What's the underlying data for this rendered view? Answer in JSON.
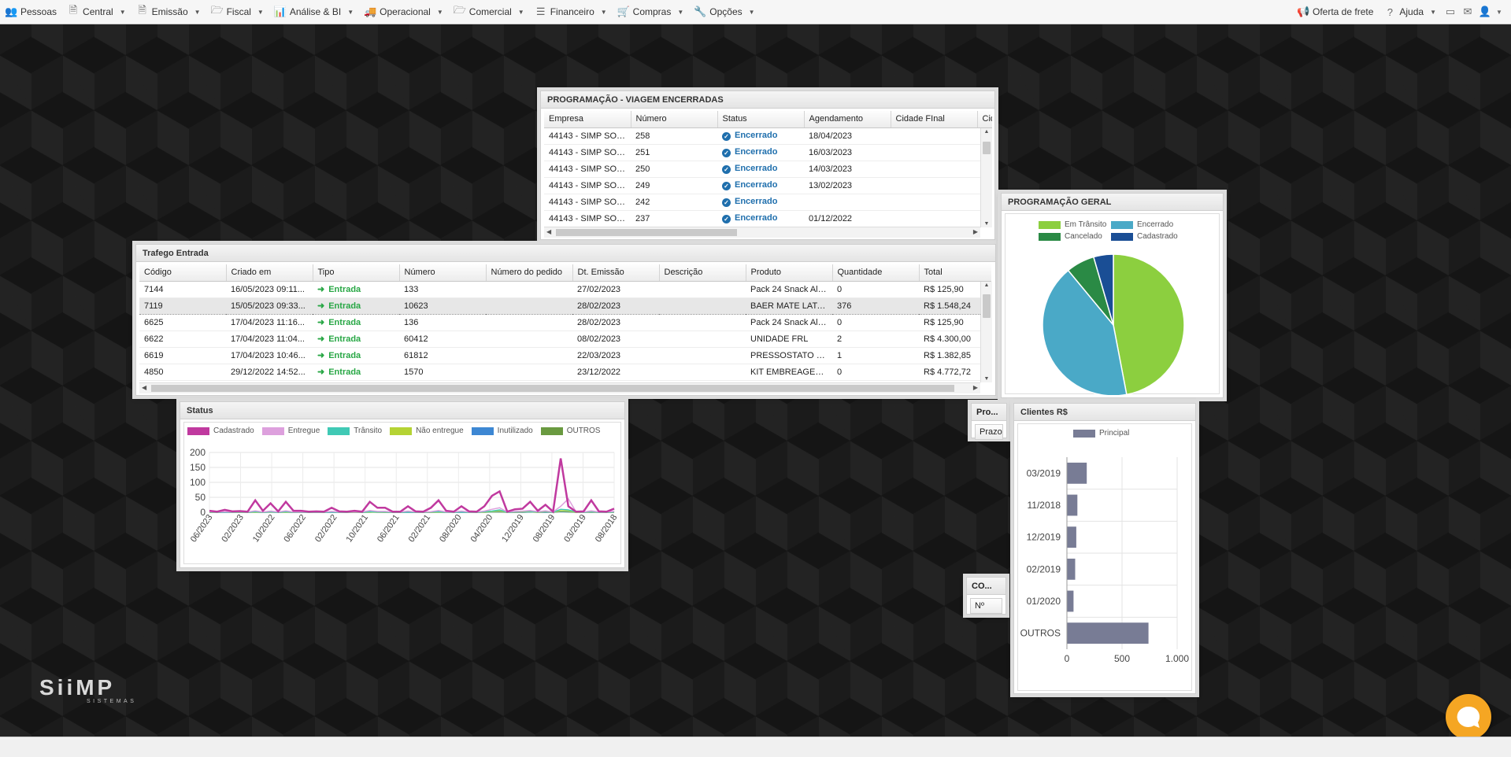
{
  "menu": {
    "items": [
      {
        "label": "Pessoas",
        "icon": "people-icon",
        "caret": false
      },
      {
        "label": "Central",
        "icon": "document-icon",
        "caret": true
      },
      {
        "label": "Emissão",
        "icon": "document-icon",
        "caret": true
      },
      {
        "label": "Fiscal",
        "icon": "folder-icon",
        "caret": true
      },
      {
        "label": "Análise & BI",
        "icon": "chart-icon",
        "caret": true
      },
      {
        "label": "Operacional",
        "icon": "truck-icon",
        "caret": true
      },
      {
        "label": "Comercial",
        "icon": "folder-icon",
        "caret": true
      },
      {
        "label": "Financeiro",
        "icon": "list-icon",
        "caret": true
      },
      {
        "label": "Compras",
        "icon": "cart-icon",
        "caret": true
      },
      {
        "label": "Opções",
        "icon": "wrench-icon",
        "caret": true
      }
    ],
    "right": {
      "frete": "Oferta de frete",
      "ajuda": "Ajuda"
    }
  },
  "viagem": {
    "title": "PROGRAMAÇÃO - VIAGEM ENCERRADAS",
    "columns": [
      "Empresa",
      "Número",
      "Status",
      "Agendamento",
      "Cidade FInal",
      "Cid"
    ],
    "rows": [
      [
        "44143 - SIMP SOF...",
        "258",
        "Encerrado",
        "18/04/2023",
        ""
      ],
      [
        "44143 - SIMP SOF...",
        "251",
        "Encerrado",
        "16/03/2023",
        ""
      ],
      [
        "44143 - SIMP SOF...",
        "250",
        "Encerrado",
        "14/03/2023",
        ""
      ],
      [
        "44143 - SIMP SOF...",
        "249",
        "Encerrado",
        "13/02/2023",
        ""
      ],
      [
        "44143 - SIMP SOF...",
        "242",
        "Encerrado",
        "",
        ""
      ],
      [
        "44143 - SIMP SOF...",
        "237",
        "Encerrado",
        "01/12/2022",
        ""
      ]
    ]
  },
  "trafego": {
    "title": "Trafego Entrada",
    "columns": [
      "Código",
      "Criado em",
      "Tipo",
      "Número",
      "Número do pedido",
      "Dt. Emissão",
      "Descrição",
      "Produto",
      "Quantidade",
      "Total"
    ],
    "rows": [
      [
        "7144",
        "16/05/2023 09:11...",
        "Entrada",
        "133",
        "",
        "27/02/2023",
        "",
        "Pack 24 Snack Alg...",
        "0",
        "R$ 125,90"
      ],
      [
        "7119",
        "15/05/2023 09:33...",
        "Entrada",
        "10623",
        "",
        "28/02/2023",
        "",
        "BAER MATE LATA ...",
        "376",
        "R$ 1.548,24"
      ],
      [
        "6625",
        "17/04/2023 11:16...",
        "Entrada",
        "136",
        "",
        "28/02/2023",
        "",
        "Pack 24 Snack Alg...",
        "0",
        "R$ 125,90"
      ],
      [
        "6622",
        "17/04/2023 11:04...",
        "Entrada",
        "60412",
        "",
        "08/02/2023",
        "",
        "UNIDADE FRL",
        "2",
        "R$ 4.300,00"
      ],
      [
        "6619",
        "17/04/2023 10:46...",
        "Entrada",
        "61812",
        "",
        "22/03/2023",
        "",
        "PRESSOSTATO DE...",
        "1",
        "R$ 1.382,85"
      ],
      [
        "4850",
        "29/12/2022 14:52...",
        "Entrada",
        "1570",
        "",
        "23/12/2022",
        "",
        "KIT EMBREAGEM ...",
        "0",
        "R$ 4.772,72"
      ]
    ],
    "selected_row": 1
  },
  "geral": {
    "title": "PROGRAMAÇÃO GERAL",
    "chart_data": {
      "type": "pie",
      "legend_position": "top",
      "slices": [
        {
          "name": "Em Trânsito",
          "value": 47,
          "color": "#8ccf3f"
        },
        {
          "name": "Encerrado",
          "value": 42,
          "color": "#4aa9c7"
        },
        {
          "name": "Cancelado",
          "value": 6.5,
          "color": "#2a8a45"
        },
        {
          "name": "Cadastrado",
          "value": 4.5,
          "color": "#1a4e95"
        }
      ]
    }
  },
  "status": {
    "title": "Status",
    "chart_data": {
      "type": "line",
      "ylim": [
        0,
        200
      ],
      "yticks": [
        "200",
        "150",
        "100",
        "50",
        "0"
      ],
      "xticks": [
        "06/2023",
        "02/2023",
        "10/2022",
        "06/2022",
        "02/2022",
        "10/2021",
        "06/2021",
        "02/2021",
        "08/2020",
        "04/2020",
        "12/2019",
        "08/2019",
        "03/2019",
        "08/2018"
      ],
      "grid": true,
      "legend_position": "top",
      "series": [
        {
          "name": "Cadastrado",
          "color": "#c0399f",
          "values": [
            5,
            2,
            8,
            3,
            4,
            2,
            40,
            5,
            30,
            3,
            35,
            5,
            5,
            2,
            3,
            2,
            15,
            3,
            2,
            5,
            2,
            35,
            15,
            15,
            2,
            2,
            20,
            3,
            2,
            15,
            40,
            5,
            2,
            20,
            3,
            2,
            20,
            55,
            70,
            2,
            10,
            12,
            35,
            5,
            25,
            2,
            180,
            20,
            2,
            3,
            40,
            3,
            2,
            12
          ]
        },
        {
          "name": "Entregue",
          "color": "#dda0dd",
          "values": [
            2,
            1,
            2,
            1,
            2,
            1,
            5,
            1,
            4,
            1,
            5,
            1,
            1,
            1,
            1,
            1,
            3,
            1,
            1,
            1,
            1,
            6,
            3,
            3,
            1,
            1,
            4,
            1,
            1,
            2,
            6,
            1,
            1,
            4,
            1,
            1,
            4,
            10,
            15,
            1,
            3,
            4,
            6,
            2,
            5,
            1,
            20,
            45,
            2,
            1,
            5,
            1,
            1,
            3
          ]
        },
        {
          "name": "Trânsito",
          "color": "#40c9b5",
          "values": [
            1,
            0,
            1,
            0,
            1,
            0,
            2,
            0,
            2,
            0,
            2,
            0,
            0,
            0,
            0,
            0,
            1,
            0,
            0,
            1,
            0,
            2,
            1,
            1,
            0,
            0,
            1,
            0,
            0,
            1,
            2,
            0,
            0,
            1,
            0,
            0,
            2,
            4,
            8,
            0,
            2,
            3,
            3,
            1,
            4,
            0,
            10,
            8,
            1,
            0,
            3,
            0,
            0,
            1
          ]
        },
        {
          "name": "Não entregue",
          "color": "#b5d334",
          "values": [
            0,
            0,
            1,
            0,
            0,
            0,
            1,
            0,
            1,
            0,
            1,
            0,
            0,
            0,
            0,
            0,
            1,
            0,
            0,
            0,
            0,
            1,
            0,
            0,
            0,
            0,
            1,
            0,
            0,
            0,
            1,
            0,
            0,
            1,
            0,
            0,
            1,
            2,
            4,
            0,
            1,
            2,
            2,
            0,
            3,
            0,
            5,
            4,
            0,
            0,
            2,
            0,
            0,
            0
          ]
        },
        {
          "name": "Inutilizado",
          "color": "#3d87d3",
          "values": [
            0,
            0,
            0,
            0,
            0,
            0,
            1,
            0,
            0,
            0,
            1,
            0,
            0,
            0,
            0,
            0,
            0,
            0,
            0,
            0,
            0,
            1,
            0,
            0,
            0,
            0,
            0,
            0,
            0,
            0,
            1,
            0,
            0,
            0,
            0,
            0,
            1,
            1,
            2,
            0,
            0,
            1,
            1,
            0,
            1,
            0,
            3,
            2,
            0,
            0,
            1,
            0,
            0,
            0
          ]
        },
        {
          "name": "OUTROS",
          "color": "#6a9a40",
          "values": [
            0,
            0,
            0,
            0,
            0,
            0,
            0,
            0,
            1,
            0,
            0,
            0,
            0,
            0,
            0,
            0,
            0,
            0,
            0,
            0,
            0,
            0,
            1,
            0,
            0,
            0,
            0,
            0,
            0,
            0,
            0,
            0,
            0,
            0,
            0,
            0,
            0,
            1,
            1,
            0,
            0,
            0,
            1,
            0,
            0,
            0,
            2,
            1,
            0,
            0,
            0,
            0,
            0,
            0
          ]
        }
      ]
    }
  },
  "clientes": {
    "title": "Clientes R$",
    "chart_data": {
      "type": "bar",
      "orientation": "horizontal",
      "legend_position": "top",
      "series": [
        {
          "name": "Principal",
          "color": "#787c95"
        }
      ],
      "categories": [
        "03/2019",
        "11/2018",
        "12/2019",
        "02/2019",
        "01/2020",
        "OUTROS"
      ],
      "values": [
        180,
        95,
        85,
        75,
        60,
        740
      ],
      "xlim": [
        0,
        1000
      ],
      "xticks": [
        "0",
        "500",
        "1.000"
      ]
    }
  },
  "mini1": {
    "title": "Pro...",
    "button": "Prazo c"
  },
  "mini2": {
    "title": "CO...",
    "button": "Nº"
  },
  "logo": {
    "text": "SiiMP",
    "sub": "SISTEMAS"
  }
}
